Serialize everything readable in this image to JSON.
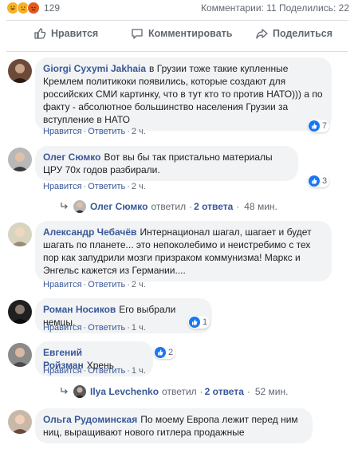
{
  "top": {
    "reaction_icons": [
      "haha-icon",
      "sad-icon",
      "angry-icon"
    ],
    "reaction_count": "129",
    "stats_text": "Комментарии: 11  Поделились: 22"
  },
  "actions": {
    "like_label": "Нравится",
    "comment_label": "Комментировать",
    "share_label": "Поделиться"
  },
  "comment_meta": {
    "like": "Нравится",
    "reply": "Ответить"
  },
  "comments": [
    {
      "author": "Giorgi Сухуmi Jakhaia",
      "text": "в Грузии тоже такие купленные Кремлем политикоки появились, которые создают для российских СМИ картинку, что в тут кто то против НАТО))) а по факту - абсолютное большинство населения Грузии за вступление в НАТО",
      "time": "2 ч.",
      "likes": "7"
    },
    {
      "author": "Олег Сюмко",
      "text": "Вот вы бы так пристально материалы ЦРУ 70х годов разбирали.",
      "time": "2 ч.",
      "likes": "3"
    },
    {
      "author": "Александр Чебачёв",
      "text": "Интернационал шагал, шагает и будет шагать по планете... это непоколебимо и неистребимо с тех пор как запудрили мозги призраком коммунизма! Маркс и Энгельс кажется из Германии....",
      "time": "2 ч.",
      "likes": ""
    },
    {
      "author": "Роман Носиков",
      "text": "Его выбрали немцы.",
      "time": "1 ч.",
      "likes": "1"
    },
    {
      "author": "Евгений Ройзман",
      "text": "Хрень",
      "time": "1 ч.",
      "likes": "2"
    },
    {
      "author": "Ольга Рудоминская",
      "text": "По моему Европа лежит перед ним ниц, выращивают нового гитлера продажные",
      "time": "",
      "likes": ""
    }
  ],
  "replies": [
    {
      "who": "Олег Сюмко",
      "verb": "ответил",
      "count": "2 ответа",
      "ago": "48 мин."
    },
    {
      "who": "Ilya Levchenko",
      "verb": "ответил",
      "count": "2 ответа",
      "ago": "52 мин."
    }
  ],
  "colors": {
    "link": "#385898",
    "bubble": "#f2f3f5",
    "like_blue": "#1877f2",
    "muted": "#606770"
  }
}
